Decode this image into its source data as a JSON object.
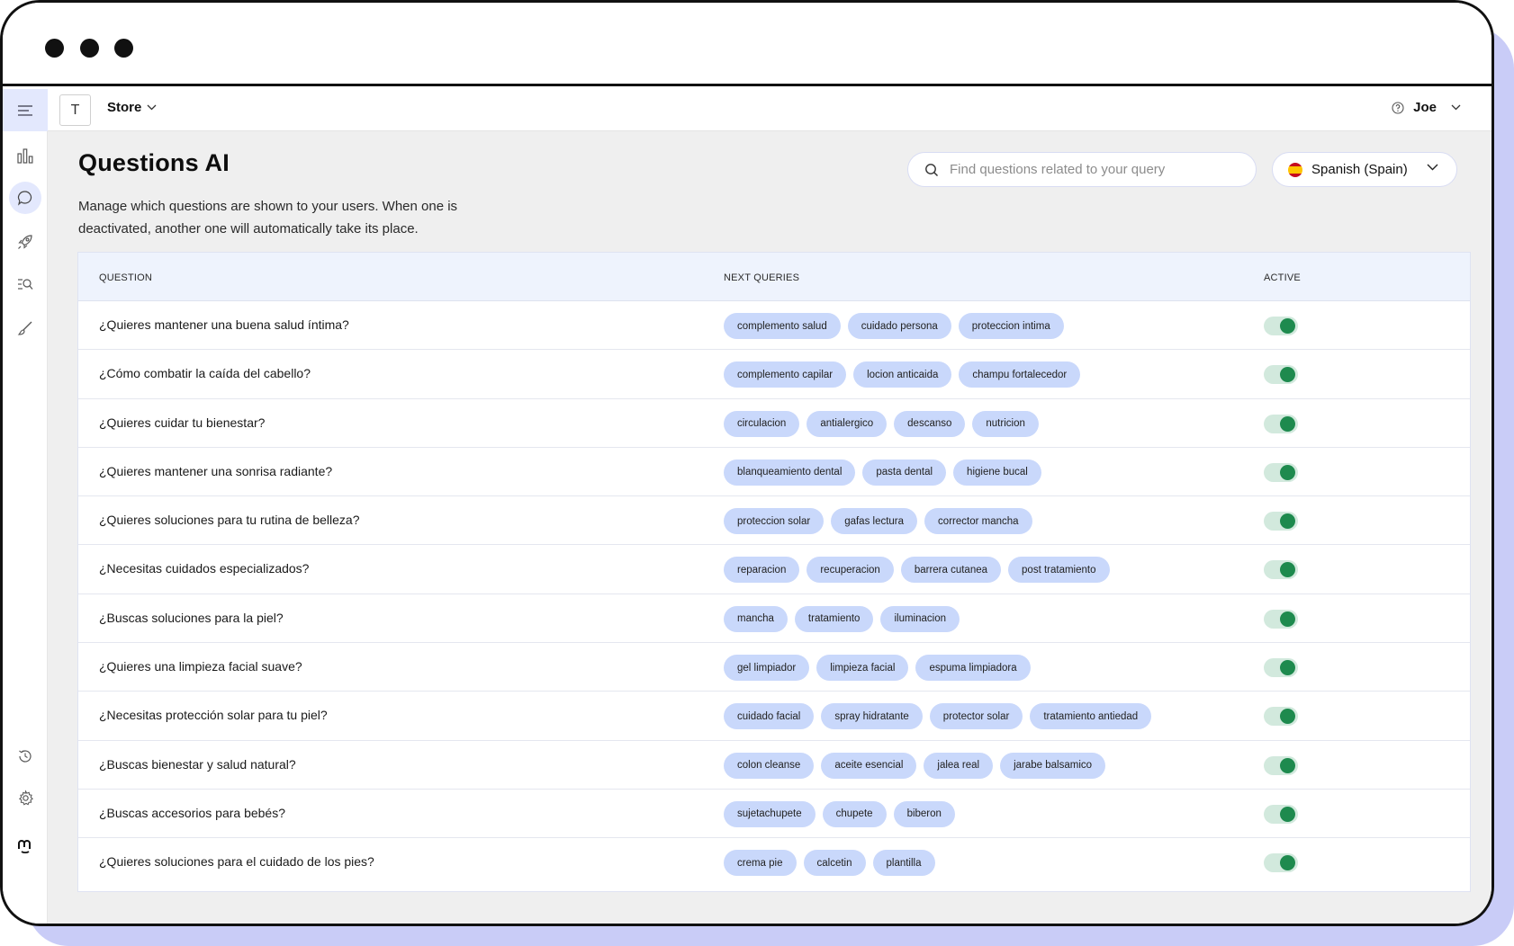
{
  "topbar": {
    "store_initial": "T",
    "store_name": "Store",
    "user_name": "Joe"
  },
  "page": {
    "title": "Questions AI",
    "description": "Manage which questions are shown to your users. When one is deactivated, another one will automatically take its place."
  },
  "search": {
    "placeholder": "Find questions related to your query"
  },
  "language": {
    "selected": "Spanish (Spain)"
  },
  "table": {
    "columns": {
      "question": "QUESTION",
      "next_queries": "NEXT QUERIES",
      "active": "ACTIVE"
    },
    "rows": [
      {
        "question": "¿Quieres mantener una buena salud íntima?",
        "chips": [
          "complemento salud",
          "cuidado persona",
          "proteccion intima"
        ],
        "active": true
      },
      {
        "question": "¿Cómo combatir la caída del cabello?",
        "chips": [
          "complemento capilar",
          "locion anticaida",
          "champu fortalecedor"
        ],
        "active": true
      },
      {
        "question": "¿Quieres cuidar tu bienestar?",
        "chips": [
          "circulacion",
          "antialergico",
          "descanso",
          "nutricion"
        ],
        "active": true
      },
      {
        "question": "¿Quieres mantener una sonrisa radiante?",
        "chips": [
          "blanqueamiento dental",
          "pasta dental",
          "higiene bucal"
        ],
        "active": true
      },
      {
        "question": "¿Quieres soluciones para tu rutina de belleza?",
        "chips": [
          "proteccion solar",
          "gafas lectura",
          "corrector mancha"
        ],
        "active": true
      },
      {
        "question": "¿Necesitas cuidados especializados?",
        "chips": [
          "reparacion",
          "recuperacion",
          "barrera cutanea",
          "post tratamiento"
        ],
        "active": true
      },
      {
        "question": "¿Buscas soluciones para la piel?",
        "chips": [
          "mancha",
          "tratamiento",
          "iluminacion"
        ],
        "active": true
      },
      {
        "question": "¿Quieres una limpieza facial suave?",
        "chips": [
          "gel limpiador",
          "limpieza facial",
          "espuma limpiadora"
        ],
        "active": true
      },
      {
        "question": "¿Necesitas protección solar para tu piel?",
        "chips": [
          "cuidado facial",
          "spray hidratante",
          "protector solar",
          "tratamiento antiedad"
        ],
        "active": true
      },
      {
        "question": "¿Buscas bienestar y salud natural?",
        "chips": [
          "colon cleanse",
          "aceite esencial",
          "jalea real",
          "jarabe balsamico"
        ],
        "active": true
      },
      {
        "question": "¿Buscas accesorios para bebés?",
        "chips": [
          "sujetachupete",
          "chupete",
          "biberon"
        ],
        "active": true
      },
      {
        "question": "¿Quieres soluciones para el cuidado de los pies?",
        "chips": [
          "crema pie",
          "calcetin",
          "plantilla"
        ],
        "active": true
      }
    ]
  },
  "colors": {
    "accent_light": "#e3e8fd",
    "chip_bg": "#c9d8fb",
    "toggle_on": "#1e8a4e",
    "frame_shadow": "#c9ccf7"
  },
  "icons": {
    "sidebar": [
      "menu-icon",
      "bar-chart-icon",
      "chat-bubble-icon",
      "rocket-icon",
      "search-list-icon",
      "brush-icon",
      "history-icon",
      "settings-icon",
      "brand-logo-icon"
    ]
  }
}
